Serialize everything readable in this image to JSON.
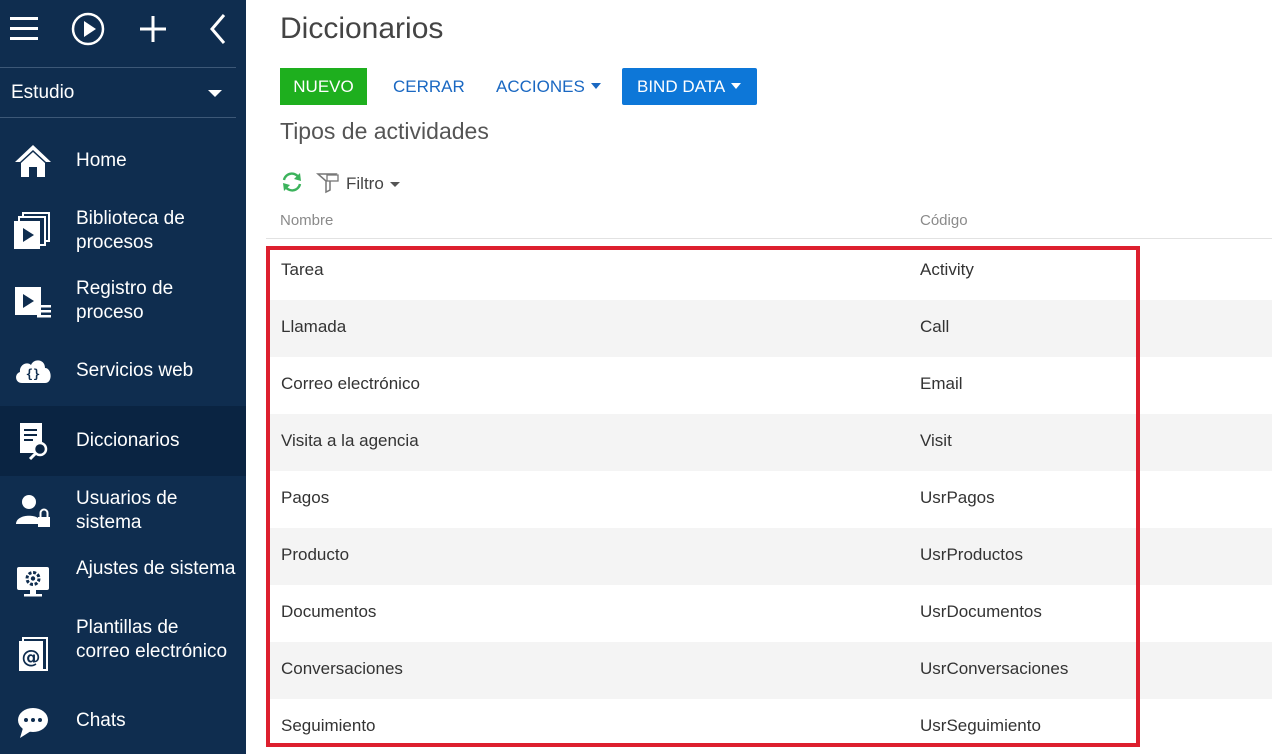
{
  "sidebar": {
    "workspace": "Estudio",
    "items": [
      {
        "label": "Home",
        "icon": "home-icon"
      },
      {
        "label": "Biblioteca de procesos",
        "icon": "process-library-icon"
      },
      {
        "label": "Registro de proceso",
        "icon": "process-log-icon"
      },
      {
        "label": "Servicios web",
        "icon": "web-services-icon"
      },
      {
        "label": "Diccionarios",
        "icon": "lookups-icon"
      },
      {
        "label": "Usuarios de sistema",
        "icon": "system-users-icon"
      },
      {
        "label": "Ajustes de sistema",
        "icon": "system-settings-icon"
      },
      {
        "label": "Plantillas de correo electrónico",
        "icon": "email-templates-icon"
      },
      {
        "label": "Chats",
        "icon": "chats-icon"
      }
    ],
    "active_item": "Diccionarios"
  },
  "header": {
    "title": "Diccionarios"
  },
  "actions": {
    "new_label": "NUEVO",
    "close_label": "CERRAR",
    "actions_label": "ACCIONES",
    "bind_label": "BIND DATA"
  },
  "section": {
    "title": "Tipos de actividades",
    "filter_label": "Filtro"
  },
  "grid": {
    "columns": [
      "Nombre",
      "Código"
    ],
    "rows": [
      {
        "name": "Tarea",
        "code": "Activity"
      },
      {
        "name": "Llamada",
        "code": "Call"
      },
      {
        "name": "Correo electrónico",
        "code": "Email"
      },
      {
        "name": "Visita a la agencia",
        "code": "Visit"
      },
      {
        "name": "Pagos",
        "code": "UsrPagos"
      },
      {
        "name": "Producto",
        "code": "UsrProductos"
      },
      {
        "name": "Documentos",
        "code": "UsrDocumentos"
      },
      {
        "name": "Conversaciones",
        "code": "UsrConversaciones"
      },
      {
        "name": "Seguimiento",
        "code": "UsrSeguimiento"
      }
    ]
  },
  "colors": {
    "sidebar_bg": "#0f2d4f",
    "sidebar_active_bg": "#0a2442",
    "new_button": "#1eaf1e",
    "bind_button": "#0d77d8",
    "link_blue": "#1a68c2",
    "highlight_border": "#dd1f2e",
    "refresh_green": "#3cb35c"
  }
}
